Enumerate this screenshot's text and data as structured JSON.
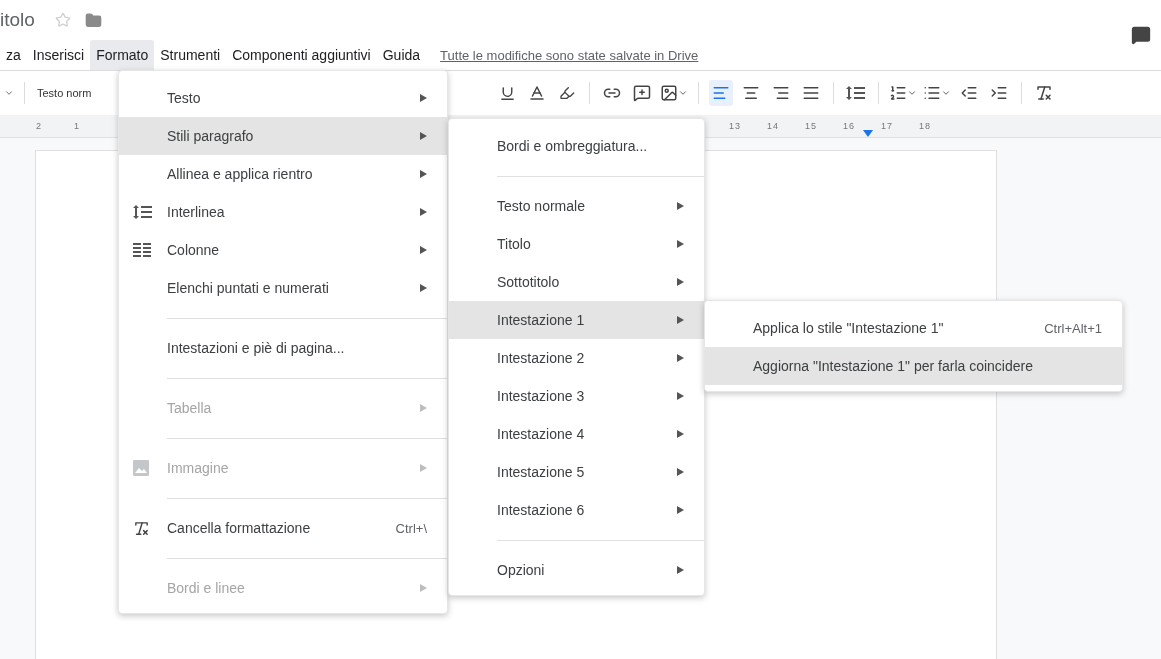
{
  "document": {
    "title": "itolo"
  },
  "menu_bar": [
    {
      "label": "za",
      "selected": false
    },
    {
      "label": "Inserisci",
      "selected": false
    },
    {
      "label": "Formato",
      "selected": true
    },
    {
      "label": "Strumenti",
      "selected": false
    },
    {
      "label": "Componenti aggiuntivi",
      "selected": false
    },
    {
      "label": "Guida",
      "selected": false
    }
  ],
  "save_status": "Tutte le modifiche sono state salvate in Drive",
  "toolbar": {
    "style_select": "Testo norm",
    "alignment_buttons": [
      {
        "selected": true
      },
      {
        "selected": false
      },
      {
        "selected": false
      },
      {
        "selected": false
      }
    ]
  },
  "ruler": {
    "left_numbers": [
      "2",
      "1"
    ],
    "right_numbers": [
      "13",
      "14",
      "15",
      "16",
      "17",
      "18"
    ]
  },
  "menus": [
    {
      "items": [
        {
          "kind": "item",
          "label": "Testo",
          "submenu": true,
          "disabled": false,
          "selected": false
        },
        {
          "kind": "item",
          "label": "Stili paragrafo",
          "submenu": true,
          "disabled": false,
          "selected": true
        },
        {
          "kind": "item",
          "label": "Allinea e applica rientro",
          "submenu": true,
          "disabled": false,
          "selected": false
        },
        {
          "kind": "item",
          "label": "Interlinea",
          "submenu": true,
          "disabled": false,
          "selected": false
        },
        {
          "kind": "item",
          "label": "Colonne",
          "submenu": true,
          "disabled": false,
          "selected": false
        },
        {
          "kind": "item",
          "label": "Elenchi puntati e numerati",
          "submenu": true,
          "disabled": false,
          "selected": false
        },
        {
          "kind": "separator"
        },
        {
          "kind": "item",
          "label": "Intestazioni e piè di pagina...",
          "submenu": false,
          "disabled": false,
          "selected": false
        },
        {
          "kind": "separator"
        },
        {
          "kind": "item",
          "label": "Tabella",
          "submenu": true,
          "disabled": true,
          "selected": false
        },
        {
          "kind": "separator"
        },
        {
          "kind": "item",
          "label": "Immagine",
          "submenu": true,
          "disabled": true,
          "selected": false
        },
        {
          "kind": "separator"
        },
        {
          "kind": "item",
          "label": "Cancella formattazione",
          "shortcut": "Ctrl+\\",
          "submenu": false,
          "disabled": false,
          "selected": false
        },
        {
          "kind": "separator"
        },
        {
          "kind": "item",
          "label": "Bordi e linee",
          "submenu": true,
          "disabled": true,
          "selected": false
        }
      ]
    },
    {
      "items": [
        {
          "kind": "item",
          "label": "Bordi e ombreggiatura...",
          "submenu": false,
          "disabled": false,
          "selected": false
        },
        {
          "kind": "separator"
        },
        {
          "kind": "item",
          "label": "Testo normale",
          "submenu": true,
          "disabled": false,
          "selected": false
        },
        {
          "kind": "item",
          "label": "Titolo",
          "submenu": true,
          "disabled": false,
          "selected": false
        },
        {
          "kind": "item",
          "label": "Sottotitolo",
          "submenu": true,
          "disabled": false,
          "selected": false
        },
        {
          "kind": "item",
          "label": "Intestazione 1",
          "submenu": true,
          "disabled": false,
          "selected": true
        },
        {
          "kind": "item",
          "label": "Intestazione 2",
          "submenu": true,
          "disabled": false,
          "selected": false
        },
        {
          "kind": "item",
          "label": "Intestazione 3",
          "submenu": true,
          "disabled": false,
          "selected": false
        },
        {
          "kind": "item",
          "label": "Intestazione 4",
          "submenu": true,
          "disabled": false,
          "selected": false
        },
        {
          "kind": "item",
          "label": "Intestazione 5",
          "submenu": true,
          "disabled": false,
          "selected": false
        },
        {
          "kind": "item",
          "label": "Intestazione 6",
          "submenu": true,
          "disabled": false,
          "selected": false
        },
        {
          "kind": "separator"
        },
        {
          "kind": "item",
          "label": "Opzioni",
          "submenu": true,
          "disabled": false,
          "selected": false
        }
      ]
    },
    {
      "items": [
        {
          "kind": "item",
          "label": "Applica lo stile \"Intestazione 1\"",
          "shortcut": "Ctrl+Alt+1",
          "submenu": false,
          "disabled": false,
          "selected": false
        },
        {
          "kind": "item",
          "label": "Aggiorna \"Intestazione 1\" per farla coincidere",
          "submenu": false,
          "disabled": false,
          "selected": true
        }
      ]
    }
  ]
}
